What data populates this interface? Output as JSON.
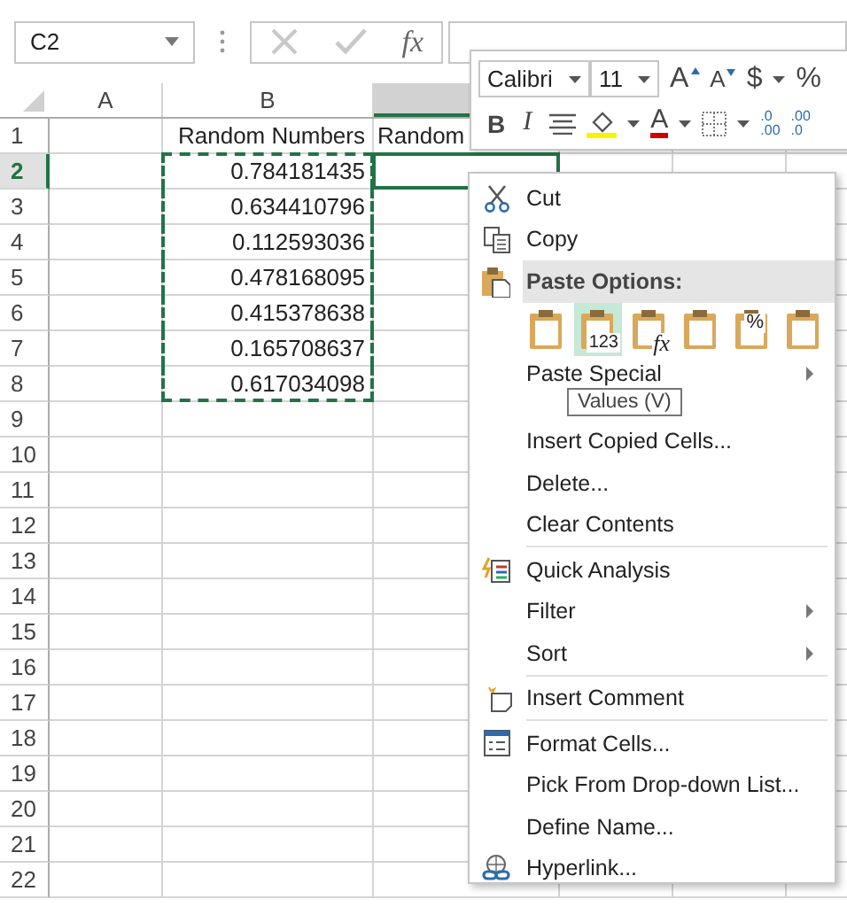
{
  "name_box": {
    "value": "C2"
  },
  "formula_bar": {
    "function_label": "fx"
  },
  "columns": [
    {
      "label": "A",
      "selected": false
    },
    {
      "label": "B",
      "selected": false
    },
    {
      "selected": true
    }
  ],
  "rows": [
    {
      "number": "1",
      "selected": false,
      "copied": false,
      "b": "Random Numbers",
      "c": "Random"
    },
    {
      "number": "2",
      "selected": true,
      "copied": true,
      "b": "0.784181435"
    },
    {
      "number": "3",
      "selected": false,
      "copied": true,
      "b": "0.634410796"
    },
    {
      "number": "4",
      "selected": false,
      "copied": true,
      "b": "0.112593036"
    },
    {
      "number": "5",
      "selected": false,
      "copied": true,
      "b": "0.478168095"
    },
    {
      "number": "6",
      "selected": false,
      "copied": true,
      "b": "0.415378638"
    },
    {
      "number": "7",
      "selected": false,
      "copied": true,
      "b": "0.165708637"
    },
    {
      "number": "8",
      "selected": false,
      "copied": true,
      "b": "0.617034098"
    },
    {
      "number": "9",
      "selected": false,
      "copied": false
    },
    {
      "number": "10",
      "selected": false,
      "copied": false
    },
    {
      "number": "11",
      "selected": false,
      "copied": false
    },
    {
      "number": "12",
      "selected": false,
      "copied": false
    },
    {
      "number": "13",
      "selected": false,
      "copied": false
    },
    {
      "number": "14",
      "selected": false,
      "copied": false
    },
    {
      "number": "15",
      "selected": false,
      "copied": false
    },
    {
      "number": "16",
      "selected": false,
      "copied": false
    },
    {
      "number": "17",
      "selected": false,
      "copied": false
    },
    {
      "number": "18",
      "selected": false,
      "copied": false
    },
    {
      "number": "19",
      "selected": false,
      "copied": false
    },
    {
      "number": "20",
      "selected": false,
      "copied": false
    },
    {
      "number": "21",
      "selected": false,
      "copied": false
    },
    {
      "number": "22",
      "selected": false,
      "copied": false
    }
  ],
  "mini_toolbar": {
    "font": "Calibri",
    "size": "11",
    "grow": "A",
    "shrink": "A",
    "currency": "$",
    "percent": "%",
    "bold": "B",
    "italic": "I",
    "font_color": "A",
    "increase_decimal": [
      ".0",
      ".00"
    ],
    "decrease_decimal": [
      ".00",
      ".0"
    ]
  },
  "context_menu": [
    {
      "kind": "item",
      "label": "Cut",
      "submenu": false
    },
    {
      "kind": "item",
      "label": "Copy",
      "submenu": false
    },
    {
      "kind": "header",
      "label": "Paste Options:"
    },
    {
      "kind": "paste_options",
      "options": [
        {
          "selected": false
        },
        {
          "selected": true,
          "label": "123"
        },
        {
          "selected": false,
          "label": "fx"
        },
        {
          "selected": false
        },
        {
          "selected": false,
          "label": "%"
        },
        {
          "selected": false
        }
      ]
    },
    {
      "kind": "item",
      "label": "Paste Special",
      "submenu": true
    },
    {
      "kind": "item",
      "label": "Insert Copied Cells...",
      "submenu": false
    },
    {
      "kind": "item",
      "label": "Delete...",
      "submenu": false
    },
    {
      "kind": "item",
      "label": "Clear Contents",
      "submenu": false
    },
    {
      "kind": "separator"
    },
    {
      "kind": "item",
      "label": "Quick Analysis",
      "submenu": false
    },
    {
      "kind": "item",
      "label": "Filter",
      "submenu": true
    },
    {
      "kind": "item",
      "label": "Sort",
      "submenu": true
    },
    {
      "kind": "separator"
    },
    {
      "kind": "item",
      "label": "Insert Comment",
      "submenu": false
    },
    {
      "kind": "separator"
    },
    {
      "kind": "item",
      "label": "Format Cells...",
      "submenu": false
    },
    {
      "kind": "item",
      "label": "Pick From Drop-down List...",
      "submenu": false
    },
    {
      "kind": "item",
      "label": "Define Name...",
      "submenu": false
    },
    {
      "kind": "item",
      "label": "Hyperlink...",
      "submenu": false
    }
  ],
  "tooltip": {
    "text": "Values (V)"
  }
}
